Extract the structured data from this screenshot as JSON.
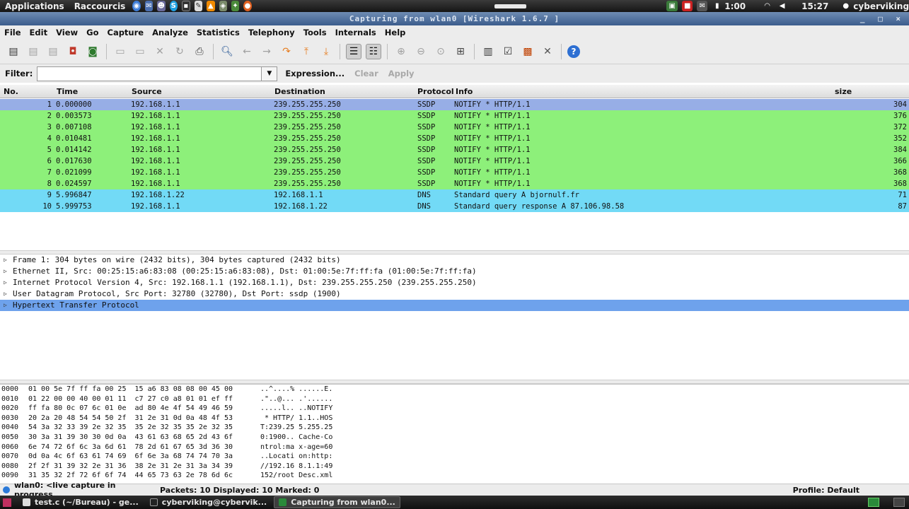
{
  "top_panel": {
    "menus": [
      "Applications",
      "Raccourcis"
    ],
    "launchers": [
      "chromium-icon",
      "thunderbird-icon",
      "pidgin-icon",
      "skype-icon",
      "terminal-icon",
      "text-editor-icon",
      "vlc-icon",
      "gimp-icon",
      "frama-c-icon",
      "firefox-icon"
    ],
    "battery": "1:00",
    "clock": "15:27",
    "user": "cyberviking"
  },
  "window": {
    "title": "Capturing from wlan0   [Wireshark 1.6.7 ]",
    "controls": "_ □ ×"
  },
  "menubar": [
    "File",
    "Edit",
    "View",
    "Go",
    "Capture",
    "Analyze",
    "Statistics",
    "Telephony",
    "Tools",
    "Internals",
    "Help"
  ],
  "filter": {
    "label": "Filter:",
    "value": "",
    "expression": "Expression...",
    "clear": "Clear",
    "apply": "Apply"
  },
  "columns": {
    "no": "No.",
    "time": "Time",
    "source": "Source",
    "destination": "Destination",
    "protocol": "Protocol",
    "info": "Info",
    "size": "size"
  },
  "packets": [
    {
      "no": "1",
      "time": "0.000000",
      "src": "192.168.1.1",
      "dst": "239.255.255.250",
      "proto": "SSDP",
      "info": "NOTIFY * HTTP/1.1",
      "size": "304"
    },
    {
      "no": "2",
      "time": "0.003573",
      "src": "192.168.1.1",
      "dst": "239.255.255.250",
      "proto": "SSDP",
      "info": "NOTIFY * HTTP/1.1",
      "size": "376"
    },
    {
      "no": "3",
      "time": "0.007108",
      "src": "192.168.1.1",
      "dst": "239.255.255.250",
      "proto": "SSDP",
      "info": "NOTIFY * HTTP/1.1",
      "size": "372"
    },
    {
      "no": "4",
      "time": "0.010481",
      "src": "192.168.1.1",
      "dst": "239.255.255.250",
      "proto": "SSDP",
      "info": "NOTIFY * HTTP/1.1",
      "size": "352"
    },
    {
      "no": "5",
      "time": "0.014142",
      "src": "192.168.1.1",
      "dst": "239.255.255.250",
      "proto": "SSDP",
      "info": "NOTIFY * HTTP/1.1",
      "size": "384"
    },
    {
      "no": "6",
      "time": "0.017630",
      "src": "192.168.1.1",
      "dst": "239.255.255.250",
      "proto": "SSDP",
      "info": "NOTIFY * HTTP/1.1",
      "size": "366"
    },
    {
      "no": "7",
      "time": "0.021099",
      "src": "192.168.1.1",
      "dst": "239.255.255.250",
      "proto": "SSDP",
      "info": "NOTIFY * HTTP/1.1",
      "size": "368"
    },
    {
      "no": "8",
      "time": "0.024597",
      "src": "192.168.1.1",
      "dst": "239.255.255.250",
      "proto": "SSDP",
      "info": "NOTIFY * HTTP/1.1",
      "size": "368"
    },
    {
      "no": "9",
      "time": "5.996847",
      "src": "192.168.1.22",
      "dst": "192.168.1.1",
      "proto": "DNS",
      "info": "Standard query A bjornulf.fr",
      "size": "71"
    },
    {
      "no": "10",
      "time": "5.999753",
      "src": "192.168.1.1",
      "dst": "192.168.1.22",
      "proto": "DNS",
      "info": "Standard query response A 87.106.98.58",
      "size": "87"
    }
  ],
  "details": [
    "Frame 1: 304 bytes on wire (2432 bits), 304 bytes captured (2432 bits)",
    "Ethernet II, Src: 00:25:15:a6:83:08 (00:25:15:a6:83:08), Dst: 01:00:5e:7f:ff:fa (01:00:5e:7f:ff:fa)",
    "Internet Protocol Version 4, Src: 192.168.1.1 (192.168.1.1), Dst: 239.255.255.250 (239.255.255.250)",
    "User Datagram Protocol, Src Port: 32780 (32780), Dst Port: ssdp (1900)",
    "Hypertext Transfer Protocol"
  ],
  "hex": [
    {
      "off": "0000",
      "bytes": "01 00 5e 7f ff fa 00 25  15 a6 83 08 08 00 45 00",
      "ascii": "..^....% ......E."
    },
    {
      "off": "0010",
      "bytes": "01 22 00 00 40 00 01 11  c7 27 c0 a8 01 01 ef ff",
      "ascii": ".\"..@... .'......"
    },
    {
      "off": "0020",
      "bytes": "ff fa 80 0c 07 6c 01 0e  ad 80 4e 4f 54 49 46 59",
      "ascii": ".....l.. ..NOTIFY"
    },
    {
      "off": "0030",
      "bytes": "20 2a 20 48 54 54 50 2f  31 2e 31 0d 0a 48 4f 53",
      "ascii": " * HTTP/ 1.1..HOS"
    },
    {
      "off": "0040",
      "bytes": "54 3a 32 33 39 2e 32 35  35 2e 32 35 35 2e 32 35",
      "ascii": "T:239.25 5.255.25"
    },
    {
      "off": "0050",
      "bytes": "30 3a 31 39 30 30 0d 0a  43 61 63 68 65 2d 43 6f",
      "ascii": "0:1900.. Cache-Co"
    },
    {
      "off": "0060",
      "bytes": "6e 74 72 6f 6c 3a 6d 61  78 2d 61 67 65 3d 36 30",
      "ascii": "ntrol:ma x-age=60"
    },
    {
      "off": "0070",
      "bytes": "0d 0a 4c 6f 63 61 74 69  6f 6e 3a 68 74 74 70 3a",
      "ascii": "..Locati on:http:"
    },
    {
      "off": "0080",
      "bytes": "2f 2f 31 39 32 2e 31 36  38 2e 31 2e 31 3a 34 39",
      "ascii": "//192.16 8.1.1:49"
    },
    {
      "off": "0090",
      "bytes": "31 35 32 2f 72 6f 6f 74  44 65 73 63 2e 78 6d 6c",
      "ascii": "152/root Desc.xml"
    }
  ],
  "status": {
    "capture": "wlan0: <live capture in progress...",
    "counts": "Packets: 10 Displayed: 10 Marked: 0",
    "profile": "Profile: Default"
  },
  "taskbar": [
    {
      "label": "test.c (~/Bureau) - ge..."
    },
    {
      "label": "cyberviking@cybervik..."
    },
    {
      "label": "Capturing from wlan0..."
    }
  ],
  "colors": {
    "ssdp": "#8df07a",
    "dns": "#72daf6",
    "selected": "#97aee6"
  }
}
